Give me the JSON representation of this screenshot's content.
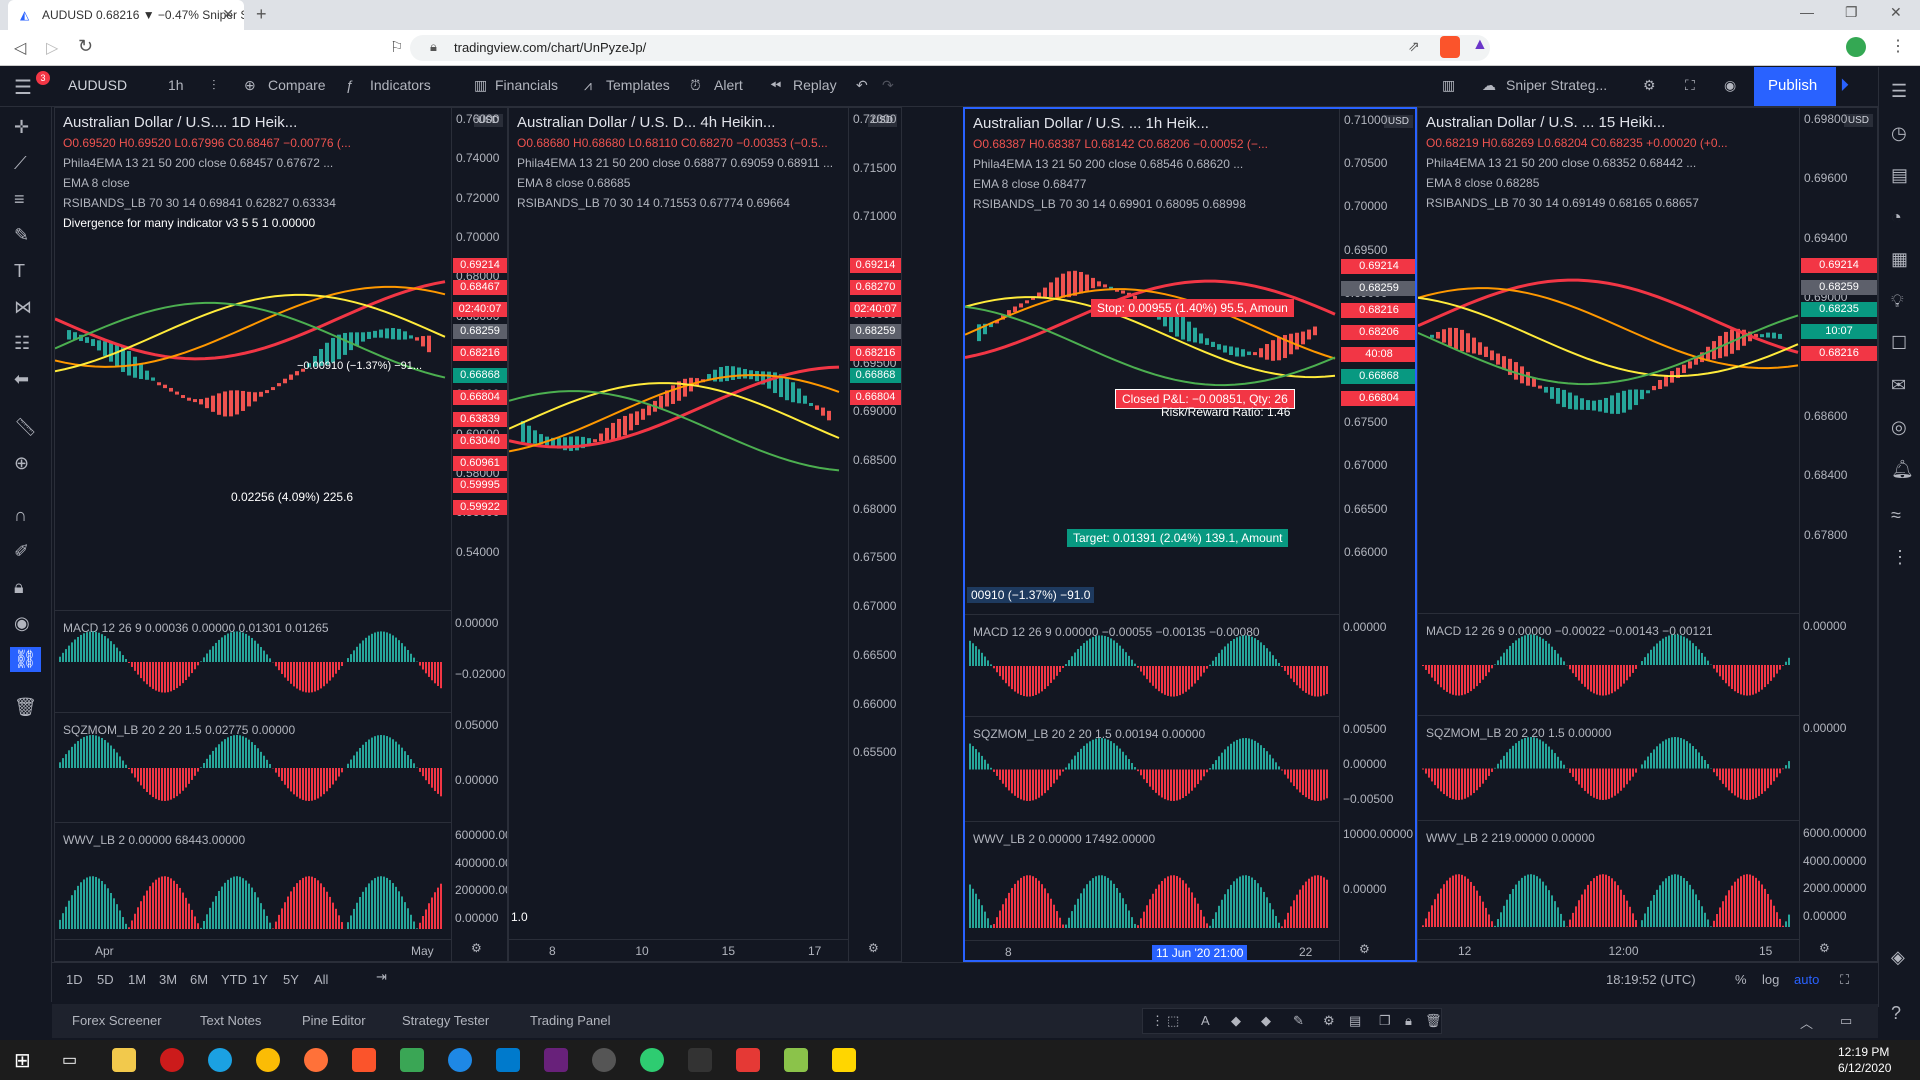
{
  "browser": {
    "tab_title": "AUDUSD 0.68216 ▼ −0.47% Sniper S",
    "url": "tradingview.com/chart/UnPyzeJp/"
  },
  "toolbar": {
    "symbol": "AUDUSD",
    "interval": "1h",
    "compare": "Compare",
    "indicators": "Indicators",
    "financials": "Financials",
    "templates": "Templates",
    "alert": "Alert",
    "replay": "Replay",
    "layout_name": "Sniper Strateg...",
    "publish": "Publish",
    "badge": "3"
  },
  "panes": [
    {
      "title": "Australian Dollar / U.S....  1D  Heik...",
      "ohlc": "O0.69520 H0.69520 L0.67996 C0.68467 −0.00776 (...",
      "ema4": "Phila4EMA 13 21 50 200 close 0.68457 0.67672 ...",
      "ema8": "EMA 8 close",
      "rsib": "RSIBANDS_LB 70 30 14 0.69841 0.62827 0.63334",
      "div": "Divergence for many indicator v3 5 5 1 0.00000",
      "macd": "MACD 12 26 9 0.00036 0.00000 0.01301 0.01265",
      "sqz": "SQZMOM_LB 20 2 20 1.5 0.02775 0.00000",
      "wwv": "WWV_LB 2 0.00000 68443.00000",
      "axis": [
        "0.76000",
        "0.74000",
        "0.72000",
        "0.70000",
        "0.68000",
        "0.66000",
        "0.64000",
        "0.62000",
        "0.60000",
        "0.58000",
        "0.56000",
        "0.54000"
      ],
      "labels": [
        {
          "v": "0.69214",
          "c": "#f23645"
        },
        {
          "v": "0.68467",
          "c": "#f23645"
        },
        {
          "v": "02:40:07",
          "c": "#f23645"
        },
        {
          "v": "0.68259",
          "c": "#5d606b"
        },
        {
          "v": "0.68216",
          "c": "#f23645"
        },
        {
          "v": "0.66868",
          "c": "#089981"
        },
        {
          "v": "0.66804",
          "c": "#f23645"
        },
        {
          "v": "0.63839",
          "c": "#f23645"
        },
        {
          "v": "0.63040",
          "c": "#f23645"
        },
        {
          "v": "0.60961",
          "c": "#f23645"
        },
        {
          "v": "0.59995",
          "c": "#f23645"
        },
        {
          "v": "0.59922",
          "c": "#f23645"
        }
      ],
      "macd_axis": [
        "0.00000",
        "−0.02000"
      ],
      "sqz_axis": [
        "0.05000",
        "0.00000"
      ],
      "wwv_axis": [
        "600000.00000",
        "400000.00000",
        "200000.00000",
        "0.00000"
      ],
      "x": [
        "Apr",
        "May"
      ],
      "note1": "−0.00910 (−1.37%) −91...",
      "note2": "0.02256 (4.09%) 225.6",
      "markers": [
        "3",
        "3",
        "2",
        "1"
      ]
    },
    {
      "title": "Australian Dollar / U.S. D...  4h  Heikin...",
      "ohlc": "O0.68680 H0.68680 L0.68110 C0.68270 −0.00353 (−0.5...",
      "ema4": "Phila4EMA 13 21 50 200 close 0.68877 0.69059 0.68911 ...",
      "ema8": "EMA 8 close 0.68685",
      "rsib": "RSIBANDS_LB 70 30 14 0.71553 0.67774 0.69664",
      "axis": [
        "0.72000",
        "0.71500",
        "0.71000",
        "0.70500",
        "0.70000",
        "0.69500",
        "0.69000",
        "0.68500",
        "0.68000",
        "0.67500",
        "0.67000",
        "0.66500",
        "0.66000",
        "0.65500"
      ],
      "labels": [
        {
          "v": "0.69214",
          "c": "#f23645"
        },
        {
          "v": "0.68270",
          "c": "#f23645"
        },
        {
          "v": "02:40:07",
          "c": "#f23645"
        },
        {
          "v": "0.68259",
          "c": "#5d606b"
        },
        {
          "v": "0.68216",
          "c": "#f23645"
        },
        {
          "v": "0.66868",
          "c": "#089981"
        },
        {
          "v": "0.66804",
          "c": "#f23645"
        }
      ],
      "x": [
        "8",
        "10",
        "15",
        "17"
      ],
      "foot": "1.0"
    },
    {
      "title": "Australian Dollar / U.S. ...  1h  Heik...",
      "ohlc": "O0.68387 H0.68387 L0.68142 C0.68206 −0.00052 (−...",
      "ema4": "Phila4EMA 13 21 50 200 close 0.68546 0.68620 ...",
      "ema8": "EMA 8 close 0.68477",
      "rsib": "RSIBANDS_LB 70 30 14 0.69901 0.68095 0.68998",
      "macd": "MACD 12 26 9 0.00000 −0.00055 −0.00135 −0.00080",
      "sqz": "SQZMOM_LB 20 2 20 1.5 0.00194 0.00000",
      "wwv": "WWV_LB 2 0.00000 17492.00000",
      "axis": [
        "0.71000",
        "0.70500",
        "0.70000",
        "0.69500",
        "0.69000",
        "0.68500",
        "0.68000",
        "0.67500",
        "0.67000",
        "0.66500",
        "0.66000"
      ],
      "labels": [
        {
          "v": "0.69214",
          "c": "#f23645"
        },
        {
          "v": "0.68259",
          "c": "#5d606b"
        },
        {
          "v": "0.68216",
          "c": "#f23645"
        },
        {
          "v": "0.68206",
          "c": "#f23645"
        },
        {
          "v": "40:08",
          "c": "#f23645"
        },
        {
          "v": "0.66868",
          "c": "#089981"
        },
        {
          "v": "0.66804",
          "c": "#f23645"
        }
      ],
      "macd_axis": [
        "0.00000"
      ],
      "sqz_axis": [
        "0.00500",
        "0.00000",
        "−0.00500"
      ],
      "wwv_axis": [
        "10000.00000",
        "0.00000"
      ],
      "x": [
        "8",
        "11 Jun '20  21:00",
        "22"
      ],
      "stop": "Stop: 0.00955 (1.40%) 95.5, Amoun",
      "closed": "Closed P&L: −0.00851, Qty: 26",
      "rr": "Risk/Reward Ratio: 1.46",
      "target": "Target: 0.01391 (2.04%) 139.1, Amount",
      "note": "00910 (−1.37%) −91.0"
    },
    {
      "title": "Australian Dollar / U.S. ...  15  Heiki...",
      "ohlc": "O0.68219 H0.68269 L0.68204 C0.68235 +0.00020 (+0...",
      "ema4": "Phila4EMA 13 21 50 200 close 0.68352 0.68442 ...",
      "ema8": "EMA 8 close 0.68285",
      "rsib": "RSIBANDS_LB 70 30 14 0.69149 0.68165 0.68657",
      "macd": "MACD 12 26 9 0.00000 −0.00022 −0.00143 −0.00121",
      "sqz": "SQZMOM_LB 20 2 20 1.5 0.00000",
      "wwv": "WWV_LB 2 219.00000 0.00000",
      "axis": [
        "0.69800",
        "0.69600",
        "0.69400",
        "0.69000",
        "0.68800",
        "0.68600",
        "0.68400",
        "0.67800"
      ],
      "labels": [
        {
          "v": "0.69214",
          "c": "#f23645"
        },
        {
          "v": "0.68259",
          "c": "#5d606b"
        },
        {
          "v": "0.68235",
          "c": "#089981"
        },
        {
          "v": "10:07",
          "c": "#089981"
        },
        {
          "v": "0.68216",
          "c": "#f23645"
        }
      ],
      "macd_axis": [
        "0.00000"
      ],
      "sqz_axis": [
        "0.00000"
      ],
      "wwv_axis": [
        "6000.00000",
        "4000.00000",
        "2000.00000",
        "0.00000"
      ],
      "x": [
        "12",
        "12:00",
        "15"
      ]
    }
  ],
  "currency": "USD",
  "ranges": [
    "1D",
    "5D",
    "1M",
    "3M",
    "6M",
    "YTD",
    "1Y",
    "5Y",
    "All"
  ],
  "clock": "18:19:52 (UTC)",
  "scale": {
    "pct": "%",
    "log": "log",
    "auto": "auto"
  },
  "bottom_tabs": [
    "Forex Screener",
    "Text Notes",
    "Pine Editor",
    "Strategy Tester",
    "Trading Panel"
  ],
  "taskbar": {
    "time": "12:19 PM",
    "date": "6/12/2020"
  }
}
